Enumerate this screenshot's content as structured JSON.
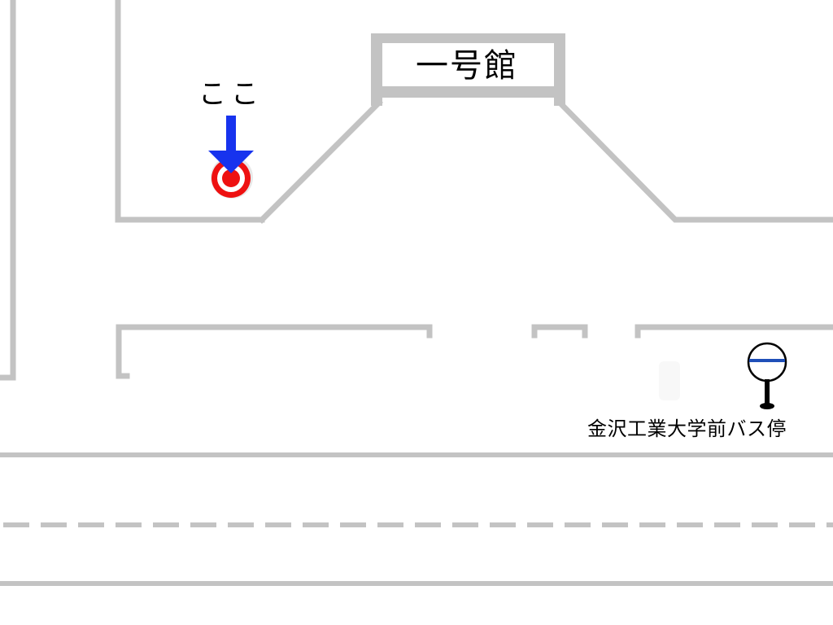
{
  "map": {
    "building": {
      "name": "一号館"
    },
    "marker": {
      "label": "ここ",
      "icon": "down-arrow-target-icon"
    },
    "bus_stop": {
      "label": "金沢工業大学前バス停",
      "icon": "bus-stop-sign-icon"
    },
    "colors": {
      "wall": "#c3c3c3",
      "arrow": "#1733ee",
      "target_red": "#ee1111",
      "bus_sign_band": "#1f4fb8"
    }
  }
}
